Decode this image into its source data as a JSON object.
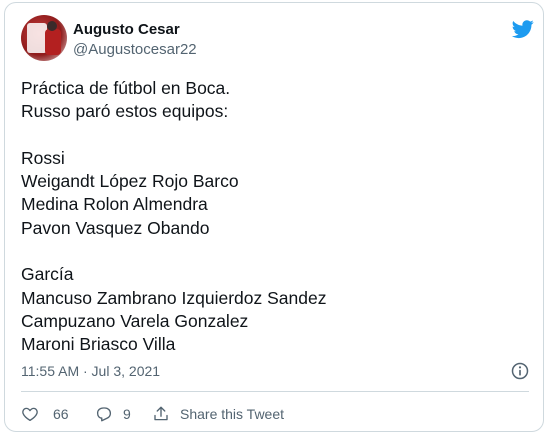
{
  "user": {
    "name": "Augusto Cesar",
    "handle": "@Augustocesar22",
    "avatar_icon": "profile-photo"
  },
  "brand": {
    "icon": "twitter-bird-icon",
    "color": "#1d9bf0"
  },
  "tweet": {
    "lines": [
      "Práctica de fútbol en Boca.",
      "Russo paró estos equipos:",
      "",
      "Rossi",
      "Weigandt López Rojo Barco",
      "Medina Rolon Almendra",
      "Pavon Vasquez Obando",
      "",
      "García",
      "Mancuso Zambrano Izquierdoz Sandez",
      "Campuzano Varela Gonzalez",
      "Maroni Briasco Villa"
    ],
    "timestamp": "11:55 AM · Jul 3, 2021"
  },
  "actions": {
    "likes": "66",
    "replies": "9",
    "share_label": "Share this Tweet"
  },
  "colors": {
    "text": "#0f1419",
    "muted": "#536471",
    "border": "#cfd9de"
  }
}
